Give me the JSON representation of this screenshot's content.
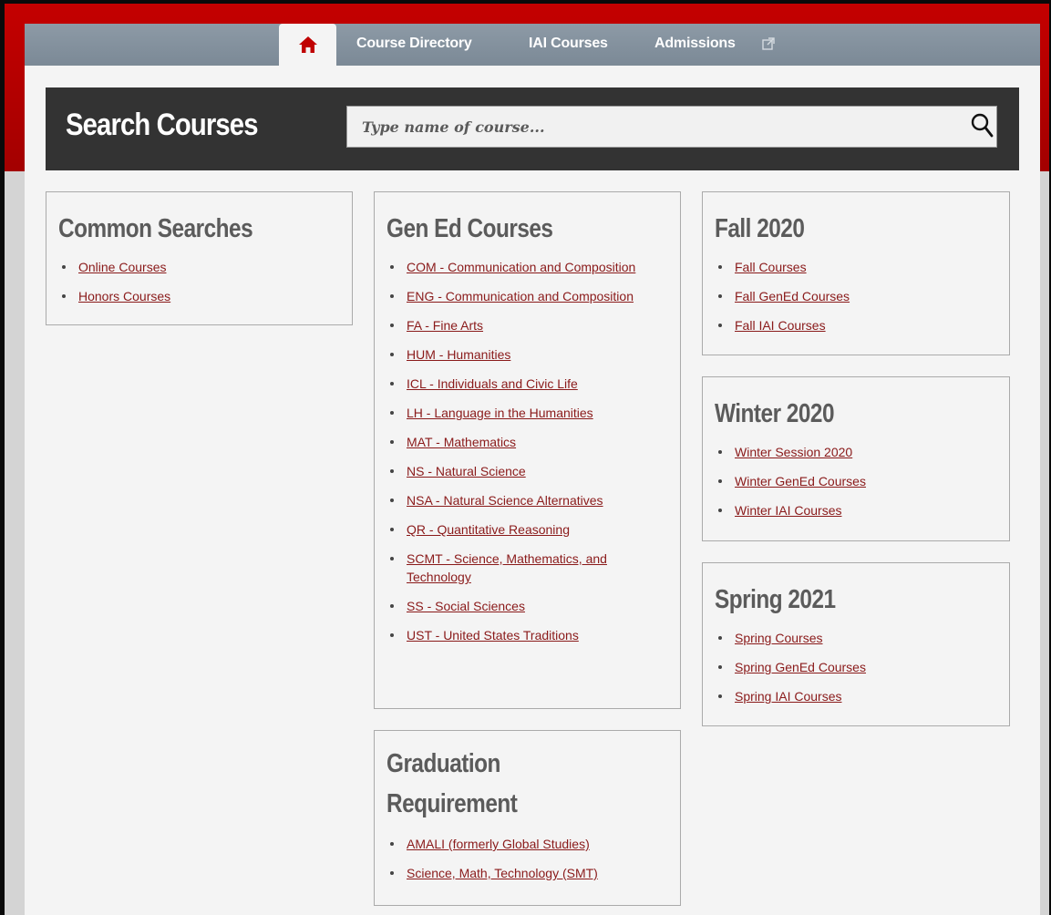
{
  "nav": {
    "items": [
      {
        "label": "Course Directory"
      },
      {
        "label": "IAI Courses"
      },
      {
        "label": "Admissions"
      }
    ]
  },
  "search": {
    "title": "Search Courses",
    "placeholder": "Type name of course..."
  },
  "sections": {
    "common": {
      "title": "Common Searches",
      "links": [
        "Online Courses",
        "Honors Courses"
      ]
    },
    "gened": {
      "title": "Gen Ed Courses",
      "links": [
        "COM - Communication and Composition",
        "ENG - Communication and Composition",
        "FA - Fine Arts",
        "HUM - Humanities",
        "ICL - Individuals and Civic Life",
        "LH - Language in the Humanities",
        "MAT - Mathematics",
        "NS - Natural Science",
        "NSA - Natural Science Alternatives",
        "QR - Quantitative Reasoning",
        "SCMT - Science, Mathematics, and Technology",
        "SS - Social Sciences",
        "UST - United States Traditions"
      ]
    },
    "graduation": {
      "title_line1": "Graduation",
      "title_line2": "Requirement",
      "links": [
        "AMALI (formerly Global Studies)",
        "Science, Math, Technology (SMT)"
      ]
    },
    "fall": {
      "title": "Fall 2020",
      "links": [
        "Fall Courses",
        "Fall GenEd Courses",
        "Fall IAI Courses"
      ]
    },
    "winter": {
      "title": "Winter 2020",
      "links": [
        "Winter Session 2020",
        "Winter GenEd Courses",
        "Winter IAI Courses"
      ]
    },
    "spring": {
      "title": "Spring 2021",
      "links": [
        "Spring Courses",
        "Spring GenEd Courses",
        "Spring IAI Courses"
      ]
    }
  },
  "colors": {
    "brand_red": "#b30000",
    "link": "#8a1a1a",
    "heading": "#5b5b5b",
    "search_bar": "#333333"
  }
}
